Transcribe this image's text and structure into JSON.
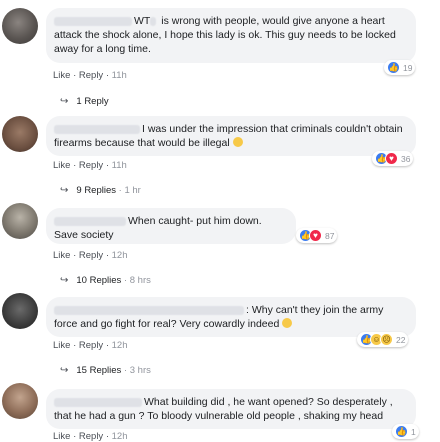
{
  "comments": [
    {
      "name_prefix": "WT",
      "text": " is wrong with people, would give anyone a heart attack the shock alone, I hope this lady is ok. This guy needs to be locked away for a long time.",
      "actions": {
        "like": "Like",
        "reply": "Reply",
        "time": "11h"
      },
      "reactions": {
        "types": [
          "like"
        ],
        "count": "19"
      },
      "replies": {
        "label": "1 Reply",
        "time": ""
      }
    },
    {
      "name_prefix": "",
      "text": "I was under the impression that criminals couldn't obtain firearms because that would be illegal",
      "emoji": "thinking-emoji",
      "actions": {
        "like": "Like",
        "reply": "Reply",
        "time": "11h"
      },
      "reactions": {
        "types": [
          "like",
          "love"
        ],
        "count": "36"
      },
      "replies": {
        "label": "9 Replies",
        "time": "1 hr"
      }
    },
    {
      "name_prefix": "",
      "text": "When caught- put him down. Save society",
      "actions": {
        "like": "Like",
        "reply": "Reply",
        "time": "12h"
      },
      "reactions": {
        "types": [
          "like",
          "love"
        ],
        "count": "87"
      },
      "replies": {
        "label": "10 Replies",
        "time": "8 hrs"
      }
    },
    {
      "name_prefix": "",
      "text": ": Why can't they join the army force and go fight for real? Very cowardly indeed",
      "emoji": "sad-emoji",
      "actions": {
        "like": "Like",
        "reply": "Reply",
        "time": "12h"
      },
      "reactions": {
        "types": [
          "like",
          "haha",
          "sad"
        ],
        "count": "22"
      },
      "replies": {
        "label": "15 Replies",
        "time": "3 hrs"
      }
    },
    {
      "name_prefix": "",
      "text": "What building did , he want opened? So desperately , that he had a gun ? To bloody vulnerable old people , shaking my head",
      "actions": {
        "like": "Like",
        "reply": "Reply",
        "time": "12h"
      },
      "reactions": {
        "types": [
          "like"
        ],
        "count": "1"
      },
      "replies": {
        "label": "",
        "time": ""
      }
    }
  ],
  "separator": " · ",
  "colors": {
    "bubble": "#f2f3f5",
    "like": "#3b7cf0",
    "love": "#f0284a",
    "haha": "#f7c948"
  }
}
